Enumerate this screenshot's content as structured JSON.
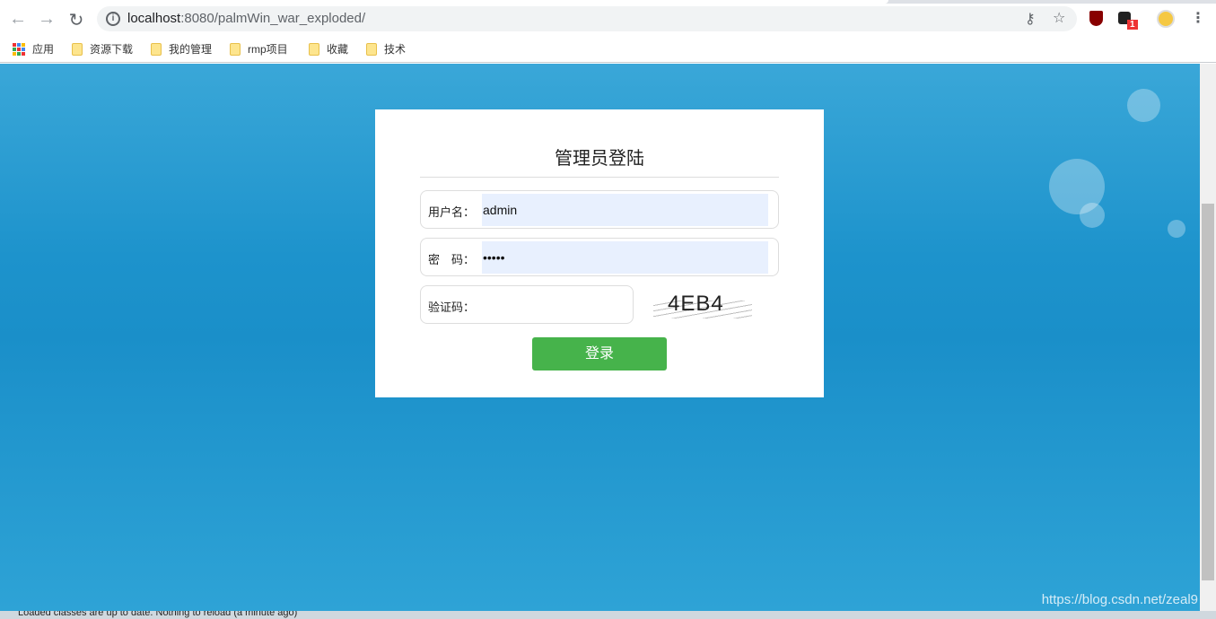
{
  "browser": {
    "url_host": "localhost",
    "url_rest": ":8080/palmWin_war_exploded/",
    "extension_badge": "1"
  },
  "bookmarks": [
    {
      "label": "应用"
    },
    {
      "label": "资源下载"
    },
    {
      "label": "我的管理"
    },
    {
      "label": "rmp项目"
    },
    {
      "label": "收藏"
    },
    {
      "label": "技术"
    }
  ],
  "login": {
    "title": "管理员登陆",
    "username_label": "用户名：",
    "username_value": "admin",
    "password_label": "密　码：",
    "password_value": "•••••",
    "captcha_label": "验证码：",
    "captcha_value": "",
    "captcha_text": "4EB4",
    "submit_label": "登录"
  },
  "watermark": "https://blog.csdn.net/zeal9",
  "status_text": "Loaded classes are up to date. Nothing to reload (a minute ago)"
}
